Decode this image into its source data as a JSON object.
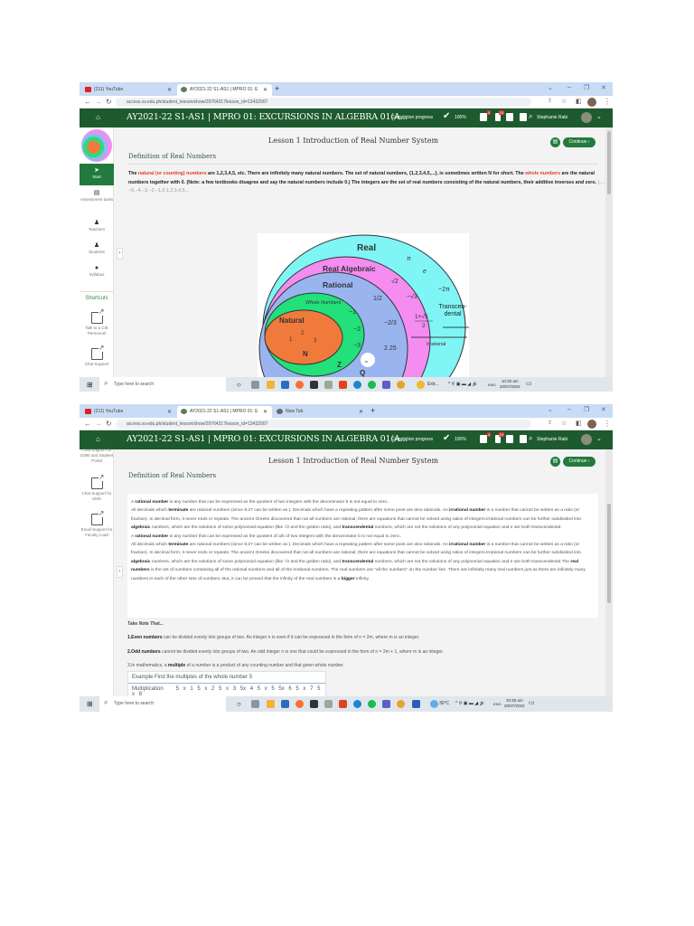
{
  "browser": {
    "tabs": [
      {
        "label": "(211) YouTube",
        "icon": "youtube-icon"
      },
      {
        "label": "AY2021-22 S1-AS1 | MPRO 01: E",
        "icon": "site-icon"
      },
      {
        "label": "New Tab",
        "icon": "chrome-icon"
      }
    ],
    "new_tab": "+",
    "url": "access.sv.edu.ph/student_lesson/show/29764317lesson_id=13432007"
  },
  "header": {
    "title": "AY2021-22 S1-AS1 | MPRO 01: EXCURSIONS IN ALGEBRA 01(A...",
    "completion_label": "Completion progress",
    "completion_value": "100%",
    "notif_badge_1": "4",
    "notif_badge_2": "10",
    "user": "Stephanie Rabi"
  },
  "lesson": {
    "title": "Lesson 1 Introduction of Real Number System",
    "section": "Definition of Real Numbers",
    "continue": "Continue ›"
  },
  "sidebar1": {
    "start": "Start",
    "items": [
      "Assessment tasks",
      "Teachers",
      "Students",
      "Syllabus"
    ],
    "shortcuts": "Shortcuts",
    "links": [
      "Talk to a CIE Personnel",
      "Chat Support"
    ]
  },
  "sidebar2": {
    "links": [
      "Chat Support for O365 and Student Portal",
      "Chat Support for UMS",
      "Email Support for Faculty Load"
    ]
  },
  "paragraph1": [
    {
      "t": "The ",
      "s": ""
    },
    {
      "t": "natural (or counting) numbers",
      "s": "red"
    },
    {
      "t": " are 1,2,3,4,5, etc. There are infinitely many natural numbers. The set  of natural numbers, {1,2,3,4,5,...}, is sometimes written N for short. The ",
      "s": ""
    },
    {
      "t": "whole numbers",
      "s": "red"
    },
    {
      "t": " are the natural numbers together with 0. (Note: a few textbooks disagree and say the natural numbers include 0.) The integers are the set of real numbers consisting of the natural numbers, their additive inverses and zero.",
      "s": ""
    },
    {
      "t": " {...,−5,−4,−3,−2,−1,0,1,2,3,4,5,..",
      "s": "gray"
    }
  ],
  "diagram": {
    "labels": {
      "real": "Real",
      "real_algebraic": "Real Algebraic",
      "rational": "Rational",
      "whole": "Whole Numbers",
      "natural": "Natural",
      "n": "N",
      "z": "Z",
      "q": "Q",
      "pi": "π",
      "e": "e",
      "sqrt2": "√2",
      "neg2pi": "−2π",
      "half": "1/2",
      "negsqrt3": "−√3",
      "neg1": "−1",
      "neg2": "−2",
      "neg3": "−3",
      "neg2thirds": "−2/3",
      "golden": "1+√5",
      "golden_den": "2",
      "transcendental": "Transcen-dental",
      "irrational": "Irrational",
      "d225": "2.25",
      "one": "1",
      "two": "2",
      "three": "3"
    },
    "colors": {
      "real": "#7ff5f5",
      "algebraic": "#f58cf0",
      "rational": "#9ab4f0",
      "whole": "#22e07a",
      "natural": "#f07a3c"
    }
  },
  "box": [
    [
      {
        "t": "A ",
        "s": ""
      },
      {
        "t": "rational number",
        "s": "bold"
      },
      {
        "t": " is any number that can be expressed as the quotient of two integers with the denominator b is not equal to zero..",
        "s": ""
      }
    ],
    [
      {
        "t": "All decimals which ",
        "s": ""
      },
      {
        "t": "terminate",
        "s": "bold"
      },
      {
        "t": " are rational numbers (since 8.27 can be written as  ). Decimals which have a repeating pattern after some point are also rationals. An ",
        "s": ""
      },
      {
        "t": "irrational number",
        "s": "bold"
      },
      {
        "t": " is a number that cannot be written as a ratio (or fraction).  In decimal form, it never ends or repeats. The ancient Greeks discovered that not all numbers are rational; there are equations that cannot be solved using ratios of integers.Irrational numbers can be further subdivided into ",
        "s": ""
      },
      {
        "t": "algebraic",
        "s": "bold"
      },
      {
        "t": " numbers, which are the solutions of some polynomial equation (like √2 and the golden ratio), and ",
        "s": ""
      },
      {
        "t": "transcendental",
        "s": "bold"
      },
      {
        "t": " numbers, which are not the solutions of any polynomial equation  and e are both transcendental.",
        "s": ""
      }
    ],
    [
      {
        "t": "A ",
        "s": ""
      },
      {
        "t": "rational number",
        "s": "bold"
      },
      {
        "t": " is any number that can be expressed as the quotient of a/b of two integers with the denominator b is not equal to zero..",
        "s": ""
      }
    ],
    [
      {
        "t": "All decimals which ",
        "s": ""
      },
      {
        "t": "terminate",
        "s": "bold"
      },
      {
        "t": " are rational numbers (since 8.27 can be written as  ). Decimals which have a repeating pattern after some point are also rationals. An ",
        "s": ""
      },
      {
        "t": "irrational number",
        "s": "bold"
      },
      {
        "t": " is a number that cannot be written as a ratio (or fraction).  In decimal form, it never ends or repeats. The ancient Greeks discovered that not all numbers are rational; there are equations that cannot be solved using ratios of integers.Irrational numbers can be further subdivided into ",
        "s": ""
      },
      {
        "t": "algebraic",
        "s": "bold"
      },
      {
        "t": " numbers, which are the solutions of some polynomial equation (like √2 and the golden ratio), and ",
        "s": ""
      },
      {
        "t": "transcendental",
        "s": "bold"
      },
      {
        "t": " numbers, which are not the solutions of any polynomial equation  and e are both transcendental.The ",
        "s": ""
      },
      {
        "t": "real numbers",
        "s": "bold"
      },
      {
        "t": " is the set of numbers containing all of the rational numbers and all of the irrational numbers.  The real numbers are \"all the numbers\" on the number line.  There are infinitely many real numbers just as there are infinitely many numbers in each of the other sets of numbers.  But, it can be proved that the infinity of the real numbers is a ",
        "s": ""
      },
      {
        "t": "bigger",
        "s": "bold"
      },
      {
        "t": " infinity.",
        "s": ""
      }
    ]
  ],
  "notes": {
    "heading": "Take Note That...",
    "items": [
      [
        {
          "t": "1.Even numbers",
          "s": "bold"
        },
        {
          "t": " can be divided evenly into groups of two. An integer n is even if it can be expressed in the form of n = 2m, where m is an integer.",
          "s": ""
        }
      ],
      [
        {
          "t": "2.Odd numbers",
          "s": "bold"
        },
        {
          "t": " cannot be divided evenly into groups of two. An odd integer n is one that could be expressed in the form of n = 2m + 1, where m is an integer.",
          "s": ""
        }
      ],
      [
        {
          "t": "3.In mathematics, a ",
          "s": ""
        },
        {
          "t": "multiple",
          "s": "bold"
        },
        {
          "t": " of a number is a product of any counting number and that given whole number.",
          "s": ""
        }
      ]
    ]
  },
  "example": {
    "heading": "Example  Find the multiples of the whole number 5",
    "row_label": "Multiplication",
    "row_values": "5 x 1  5 x 2  5 x 3  5x 4  5 x 5  5x 6  5 x 7  5 x 8"
  },
  "taskbar": {
    "search_placeholder": "Type here to search",
    "edge_tab": "Extr...",
    "weather": "30°C",
    "lang": "ENG",
    "time": "10:30 am",
    "date": "20/07/2022"
  }
}
